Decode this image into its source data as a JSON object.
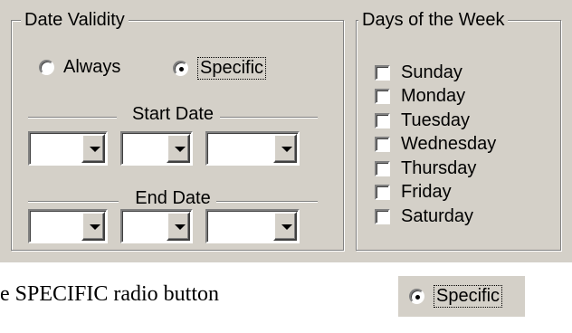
{
  "date_validity": {
    "title": "Date Validity",
    "radio_always": "Always",
    "radio_specific": "Specific",
    "selected": "Specific",
    "start_date_label": "Start Date",
    "end_date_label": "End Date"
  },
  "days_of_week": {
    "title": "Days of the Week",
    "days": [
      "Sunday",
      "Monday",
      "Tuesday",
      "Wednesday",
      "Thursday",
      "Friday",
      "Saturday"
    ]
  },
  "caption": {
    "text": "e SPECIFIC radio button",
    "zoom_label": "Specific"
  }
}
